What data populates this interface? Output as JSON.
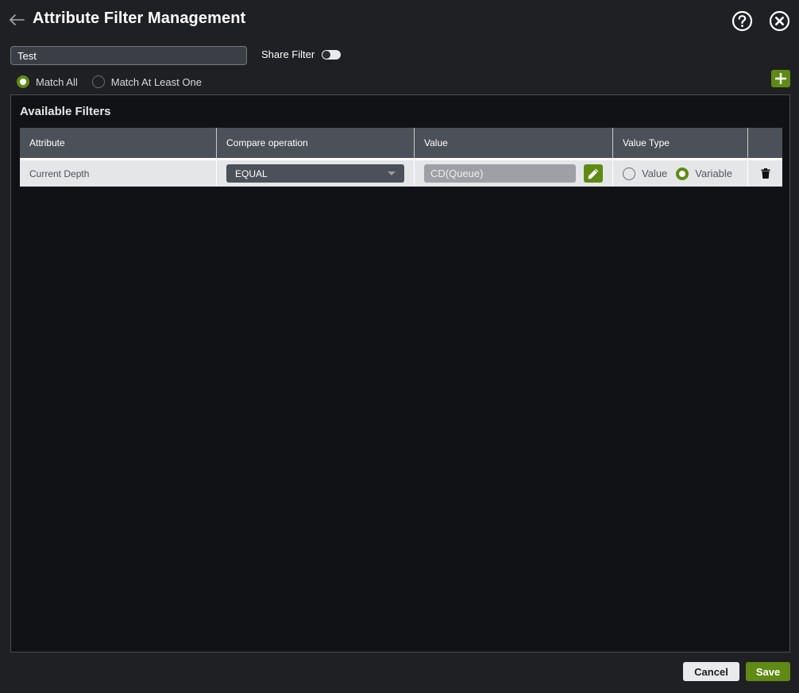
{
  "header": {
    "title": "Attribute Filter Management",
    "icons": {
      "back": "arrow-left-icon",
      "help": "question-circle-icon",
      "close": "close-circle-icon"
    }
  },
  "filter": {
    "name_value": "Test",
    "share_label": "Share Filter",
    "share_enabled": false
  },
  "match": {
    "options": [
      {
        "label": "Match All",
        "checked": true
      },
      {
        "label": "Match At Least One",
        "checked": false
      }
    ]
  },
  "panel": {
    "title": "Available Filters",
    "columns": [
      "Attribute",
      "Compare operation",
      "Value",
      "Value Type",
      ""
    ],
    "rows": [
      {
        "attribute": "Current Depth",
        "compare": "EQUAL",
        "value": "CD(Queue)",
        "value_type_options": [
          {
            "label": "Value",
            "checked": false
          },
          {
            "label": "Variable",
            "checked": true
          }
        ]
      }
    ]
  },
  "footer": {
    "cancel_label": "Cancel",
    "save_label": "Save"
  },
  "colors": {
    "background": "#1f2024",
    "panel": "#111215",
    "accent": "#5f8a14",
    "table_header": "#4c5058",
    "row": "#e5e6e8"
  }
}
